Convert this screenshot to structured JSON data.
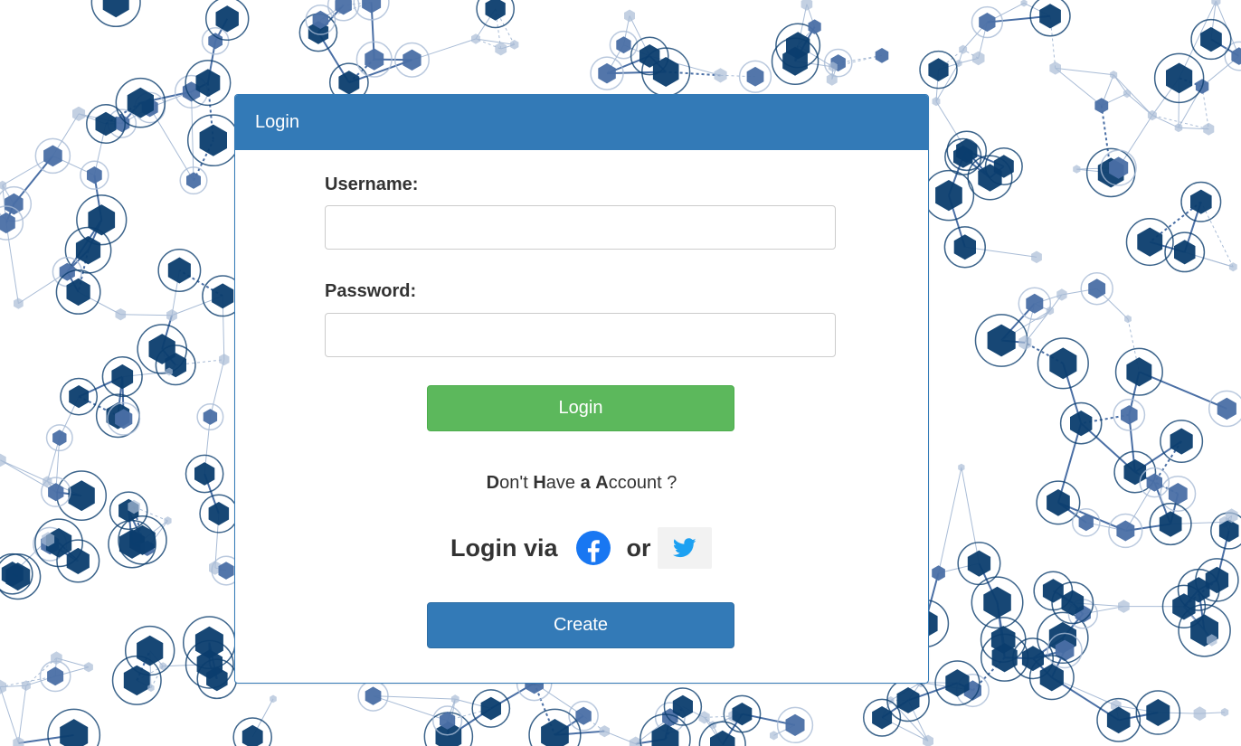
{
  "panel": {
    "title": "Login"
  },
  "form": {
    "username_label": "Username:",
    "username_value": "",
    "password_label": "Password:",
    "password_value": "",
    "login_button": "Login"
  },
  "account_prompt": [
    {
      "text": "D",
      "bold": true
    },
    {
      "text": "on't ",
      "bold": false
    },
    {
      "text": "H",
      "bold": true
    },
    {
      "text": "ave ",
      "bold": false
    },
    {
      "text": "a",
      "bold": true
    },
    {
      "text": " ",
      "bold": false
    },
    {
      "text": "A",
      "bold": true
    },
    {
      "text": "ccount ?",
      "bold": false
    }
  ],
  "social": {
    "login_via": "Login via",
    "or": "or",
    "facebook_icon": "facebook-icon",
    "twitter_icon": "twitter-icon"
  },
  "create_button": "Create",
  "colors": {
    "primary": "#337ab7",
    "success": "#5cb85c",
    "facebook": "#1877f2",
    "twitter": "#1da1f2",
    "network_dark": "#0b3d6e",
    "network_mid": "#4a6fa5",
    "network_light": "#a9bcd6"
  }
}
